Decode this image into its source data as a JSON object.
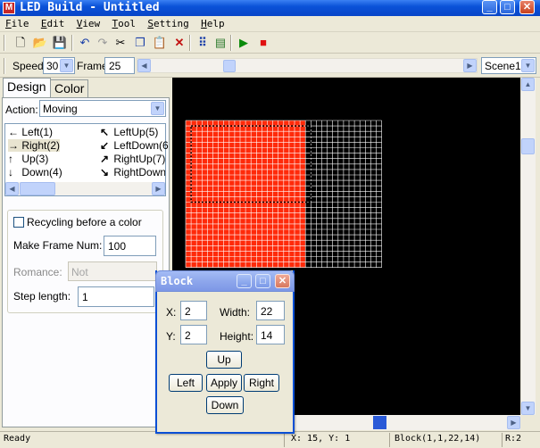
{
  "window": {
    "title": "LED Build - Untitled",
    "icon_label": "M"
  },
  "menu": [
    {
      "label": "File",
      "key": "F",
      "rest": "ile"
    },
    {
      "label": "Edit",
      "key": "E",
      "rest": "dit"
    },
    {
      "label": "View",
      "key": "V",
      "rest": "iew"
    },
    {
      "label": "Tool",
      "key": "T",
      "rest": "ool"
    },
    {
      "label": "Setting",
      "key": "S",
      "rest": "etting"
    },
    {
      "label": "Help",
      "key": "H",
      "rest": "elp"
    }
  ],
  "toolbar": {
    "icons": [
      "new-file-icon",
      "open-folder-icon",
      "save-icon",
      "undo-icon",
      "redo-icon",
      "cut-icon",
      "copy-icon",
      "paste-icon",
      "delete-icon",
      "grid-icon",
      "properties-icon",
      "play-icon",
      "stop-icon"
    ]
  },
  "toolbar2": {
    "speed_label": "Speed:",
    "speed_value": "30",
    "frame_label": "Frame:",
    "frame_value": "25",
    "scene_value": "Scene1"
  },
  "tabs": {
    "design": "Design",
    "color": "Color"
  },
  "action": {
    "label": "Action:",
    "value": "Moving"
  },
  "actions": [
    {
      "label": "Left(1)",
      "icon": "←"
    },
    {
      "label": "Right(2)",
      "icon": "→"
    },
    {
      "label": "Up(3)",
      "icon": "↑"
    },
    {
      "label": "Down(4)",
      "icon": "↓"
    },
    {
      "label": "LeftUp(5)",
      "icon": "↖"
    },
    {
      "label": "LeftDown(6",
      "icon": "↙"
    },
    {
      "label": "RightUp(7)",
      "icon": "↗"
    },
    {
      "label": "RightDown(",
      "icon": "↘"
    }
  ],
  "options": {
    "recycling_label": "Recycling before a color",
    "make_frame_label": "Make Frame Num:",
    "make_frame_value": "100",
    "romance_label": "Romance:",
    "romance_value": "Not",
    "step_label": "Step length:",
    "step_value": "1"
  },
  "block": {
    "title": "Block",
    "x_label": "X:",
    "x_value": "2",
    "y_label": "Y:",
    "y_value": "2",
    "width_label": "Width:",
    "width_value": "22",
    "height_label": "Height:",
    "height_value": "14",
    "up": "Up",
    "left": "Left",
    "apply": "Apply",
    "right": "Right",
    "down": "Down"
  },
  "status": {
    "ready": "Ready",
    "coords": "X: 15, Y: 1",
    "block": "Block(1,1,22,14)",
    "r": "R:2"
  },
  "grid": {
    "cols": 36,
    "rows": 27,
    "red_cols": 22,
    "red_color": "#ff2a0a",
    "off_color": "#000000",
    "line_color": "#ffffff"
  }
}
